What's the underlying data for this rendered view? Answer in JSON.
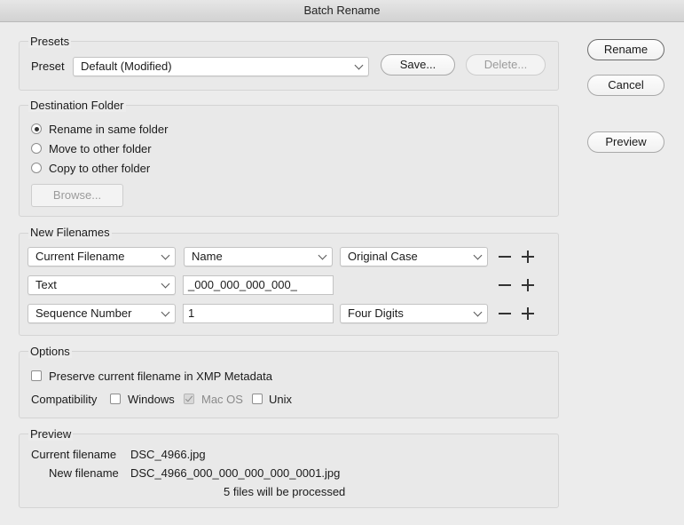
{
  "window": {
    "title": "Batch Rename"
  },
  "buttons": {
    "rename": "Rename",
    "cancel": "Cancel",
    "preview": "Preview"
  },
  "presets": {
    "legend": "Presets",
    "preset_label": "Preset",
    "preset_value": "Default (Modified)",
    "save": "Save...",
    "delete": "Delete..."
  },
  "destination": {
    "legend": "Destination Folder",
    "options": [
      {
        "label": "Rename in same folder",
        "selected": true
      },
      {
        "label": "Move to other folder",
        "selected": false
      },
      {
        "label": "Copy to other folder",
        "selected": false
      }
    ],
    "browse": "Browse..."
  },
  "new_filenames": {
    "legend": "New Filenames",
    "rows": [
      {
        "type": "Current Filename",
        "field": "Name",
        "option": "Original Case"
      },
      {
        "type": "Text",
        "text": "_000_000_000_000_"
      },
      {
        "type": "Sequence Number",
        "text": "1",
        "option": "Four Digits"
      }
    ]
  },
  "options": {
    "legend": "Options",
    "preserve": {
      "label": "Preserve current filename in XMP Metadata",
      "checked": false
    },
    "compat_label": "Compatibility",
    "compat": [
      {
        "label": "Windows",
        "checked": false,
        "disabled": false
      },
      {
        "label": "Mac OS",
        "checked": true,
        "disabled": true
      },
      {
        "label": "Unix",
        "checked": false,
        "disabled": false
      }
    ]
  },
  "preview": {
    "legend": "Preview",
    "current_label": "Current filename",
    "current_value": "DSC_4966.jpg",
    "new_label": "New filename",
    "new_value": "DSC_4966_000_000_000_000_0001.jpg",
    "status": "5 files will be processed"
  }
}
